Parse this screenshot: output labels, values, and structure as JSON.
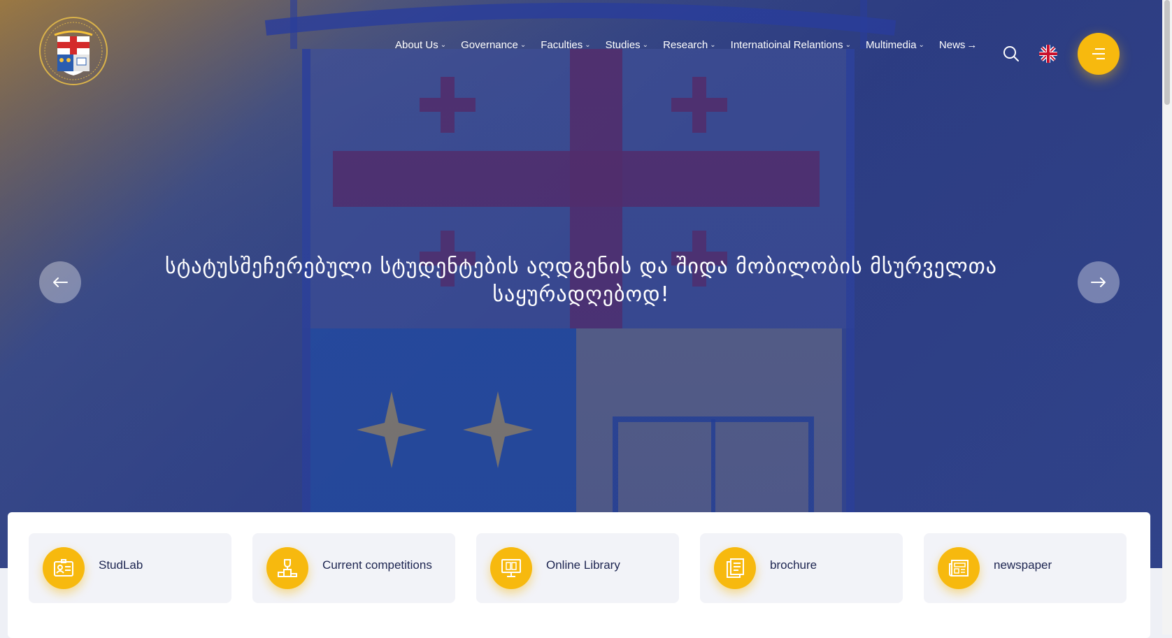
{
  "colors": {
    "accent": "#f7b90e",
    "hero": "#2e3e83",
    "text_dark": "#1c2450"
  },
  "header": {
    "logo": "university-seal-logo",
    "nav": [
      {
        "label": "About Us",
        "has_dropdown": true
      },
      {
        "label": "Governance",
        "has_dropdown": true
      },
      {
        "label": "Faculties",
        "has_dropdown": true
      },
      {
        "label": "Studies",
        "has_dropdown": true
      },
      {
        "label": "Research",
        "has_dropdown": true
      },
      {
        "label": "Internatioinal Relantions",
        "has_dropdown": true
      },
      {
        "label": "Multimedia",
        "has_dropdown": true
      },
      {
        "label": "News",
        "has_arrow": true
      }
    ],
    "icons": [
      "search-icon",
      "uk-flag-icon",
      "menu-icon"
    ]
  },
  "hero": {
    "title_line1": "სტატუსშეჩერებული სტუდენტების აღდგენის და შიდა მობილობის მსურველთა",
    "title_line2": "საყურადღებოდ!",
    "prev_icon": "arrow-left-icon",
    "next_icon": "arrow-right-icon"
  },
  "quick_links": [
    {
      "label": "StudLab",
      "icon": "id-card-icon"
    },
    {
      "label": "Current competitions",
      "icon": "trophy-podium-icon"
    },
    {
      "label": "Online Library",
      "icon": "computer-book-icon"
    },
    {
      "label": "brochure",
      "icon": "document-icon"
    },
    {
      "label": "newspaper",
      "icon": "newspaper-icon"
    }
  ]
}
